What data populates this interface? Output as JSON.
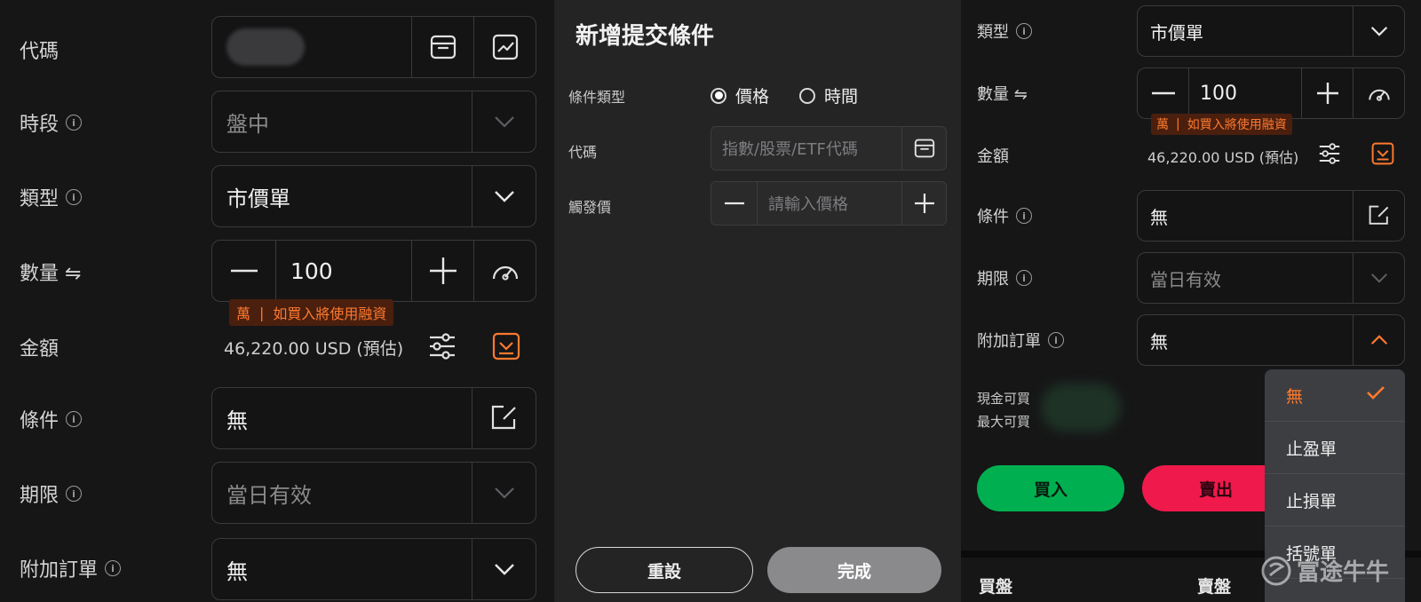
{
  "left": {
    "code_label": "代碼",
    "session_label": "時段",
    "session_value": "盤中",
    "type_label": "類型",
    "type_value": "市價單",
    "qty_label": "數量 ⇋",
    "qty_value": "100",
    "margin_tag_a": "萬",
    "margin_tag_sep": "|",
    "margin_tag_b": "如買入將使用融資",
    "amount_label": "金額",
    "amount_value": "46,220.00 USD (預估)",
    "condition_label": "條件",
    "condition_value": "無",
    "expiry_label": "期限",
    "expiry_value": "當日有效",
    "attached_label": "附加訂單",
    "attached_value": "無"
  },
  "modal": {
    "title": "新增提交條件",
    "cond_type_label": "條件類型",
    "option_price": "價格",
    "option_time": "時間",
    "selected_option": "價格",
    "code_label": "代碼",
    "code_placeholder": "指數/股票/ETF代碼",
    "trigger_label": "觸發價",
    "trigger_placeholder": "請輸入價格",
    "reset_label": "重設",
    "done_label": "完成"
  },
  "right": {
    "type_label": "類型",
    "type_value": "市價單",
    "qty_label": "數量 ⇋",
    "qty_value": "100",
    "margin_tag_a": "萬",
    "margin_tag_sep": "|",
    "margin_tag_b": "如買入將使用融資",
    "amount_label": "金額",
    "amount_value": "46,220.00 USD (預估)",
    "condition_label": "條件",
    "condition_value": "無",
    "expiry_label": "期限",
    "expiry_value": "當日有效",
    "attached_label": "附加訂單",
    "attached_value": "無",
    "cash_buy_label": "現金可買",
    "max_buy_label": "最大可買",
    "buy_label": "買入",
    "sell_label": "賣出",
    "bid_label": "買盤",
    "ask_label": "賣盤",
    "dropdown": [
      "無",
      "止盈單",
      "止損單",
      "括號單"
    ],
    "dropdown_selected": "無"
  },
  "watermark": "富途牛牛",
  "colors": {
    "accent": "#ff7a2e",
    "buy": "#00b050",
    "sell": "#f0194b"
  }
}
